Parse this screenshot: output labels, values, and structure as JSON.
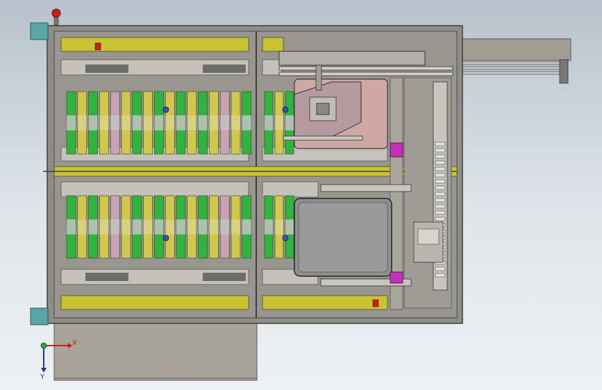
{
  "viewport": {
    "background_top": "#b8c2cc",
    "background_bottom": "#eef1f4"
  },
  "colors": {
    "frame": "#8e8c86",
    "frame_dark": "#4a4a48",
    "panel_yellow": "#c9c233",
    "roller_green": "#2fb53c",
    "roller_yellow": "#cfc84a",
    "roller_pink": "#c9a3b4",
    "roller_gray": "#b9b9b9",
    "plate_pink": "#cfa8a4",
    "plate_gray": "#8f8f8f",
    "magenta": "#c431b8",
    "teal_block": "#5aa6a6",
    "red_knob": "#d11b1b"
  },
  "axis_triad": {
    "x_label": "X",
    "y_label": "Y",
    "x_color": "#d11b1b",
    "y_color": "#1b2fb0",
    "origin_color": "#1fa53a"
  },
  "conveyor": {
    "upper_row_pattern": [
      "green",
      "yellow",
      "green",
      "yellow",
      "pink",
      "yellow",
      "green",
      "yellow",
      "green",
      "yellow",
      "green",
      "yellow",
      "green",
      "yellow",
      "pink",
      "yellow",
      "green"
    ],
    "right_row_pattern": [
      "green",
      "yellow",
      "green"
    ]
  }
}
